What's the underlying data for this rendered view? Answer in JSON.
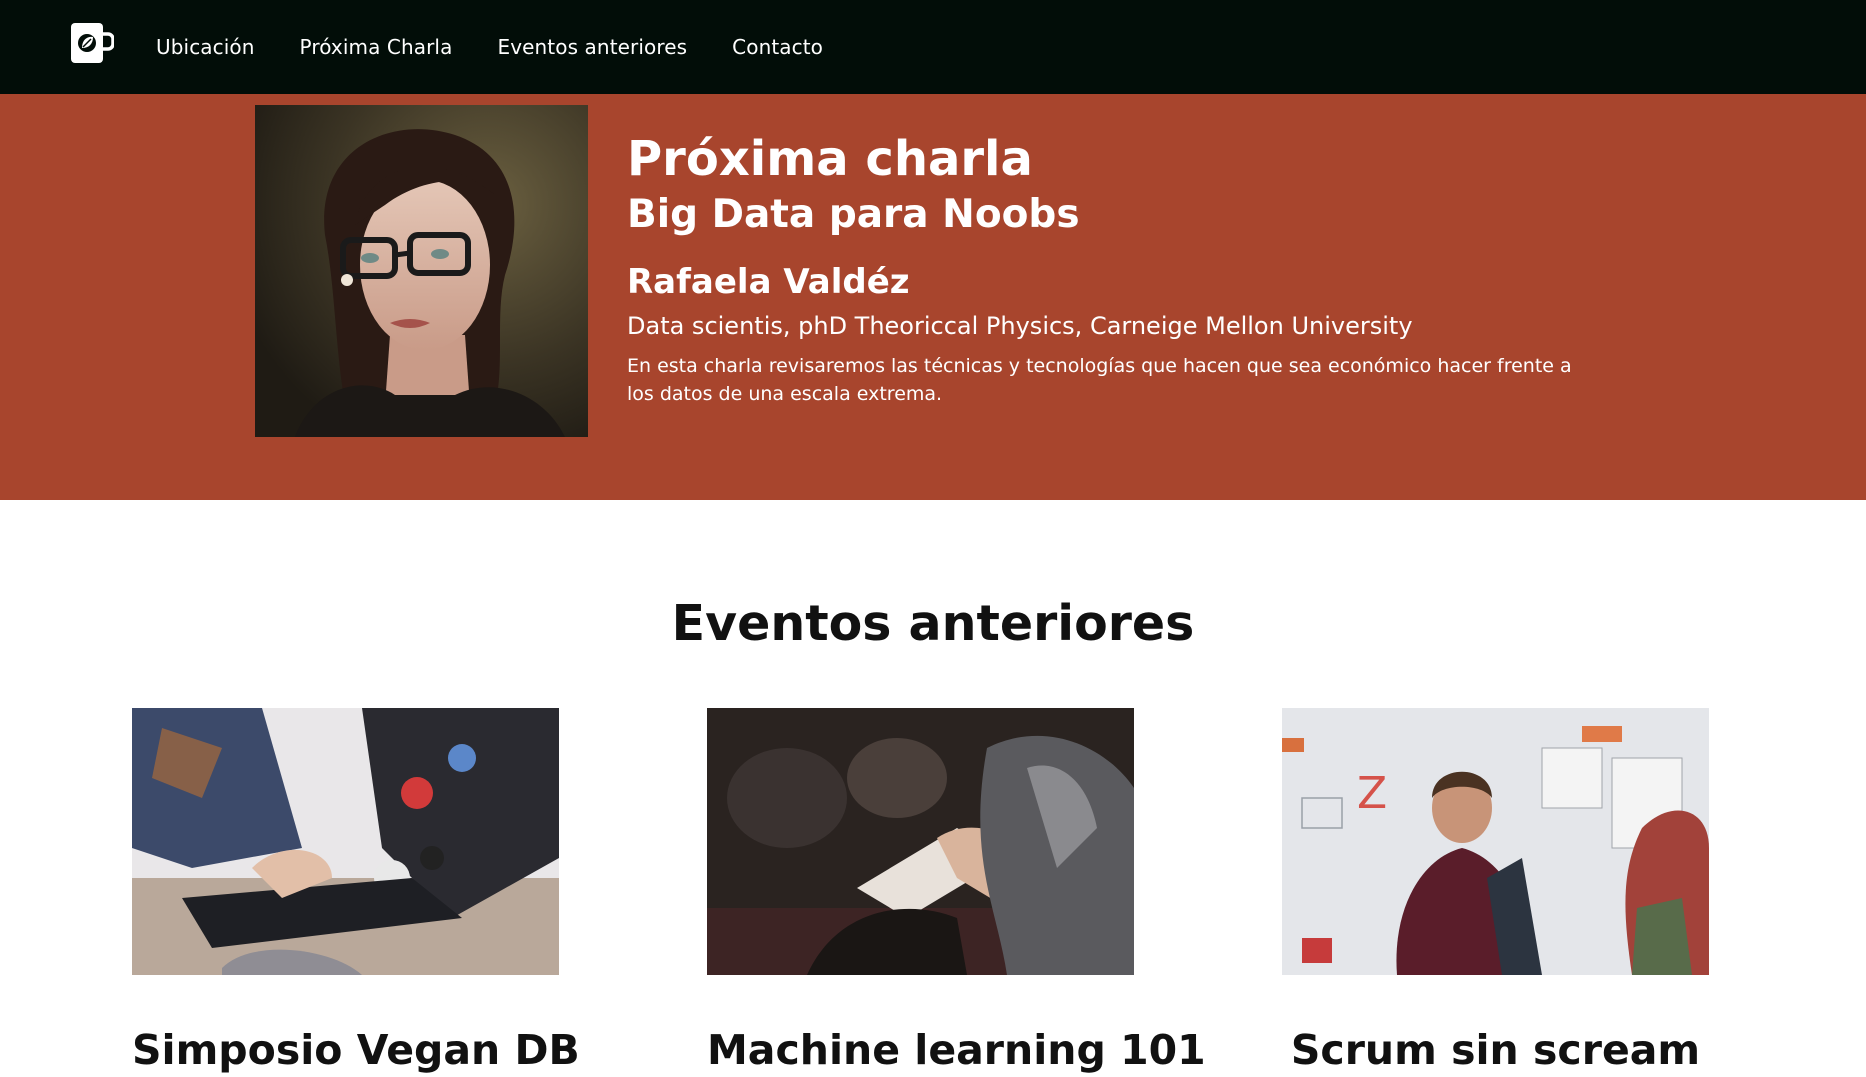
{
  "nav": {
    "logo_icon": "coffee-mug-leaf-icon",
    "links": [
      "Ubicación",
      "Próxima Charla",
      "Eventos anteriores",
      "Contacto"
    ]
  },
  "hero": {
    "kicker": "Próxima charla",
    "title": "Big Data para Noobs",
    "speaker_name": "Rafaela Valdéz",
    "speaker_bio": "Data scientis, phD Theoriccal Physics, Carneige Mellon University",
    "description": "En esta charla revisaremos las técnicas y tecnologías que hacen que sea económico hacer frente a los datos de una escala extrema.",
    "background_color": "#a8452d"
  },
  "previous_events": {
    "title": "Eventos anteriores",
    "events": [
      {
        "title": "Simposio Vegan DB"
      },
      {
        "title": "Machine learning 101"
      },
      {
        "title": "Scrum sin scream"
      }
    ]
  },
  "colors": {
    "navbar": "#020d08",
    "accent": "#a8452d",
    "text_dark": "#111111"
  }
}
